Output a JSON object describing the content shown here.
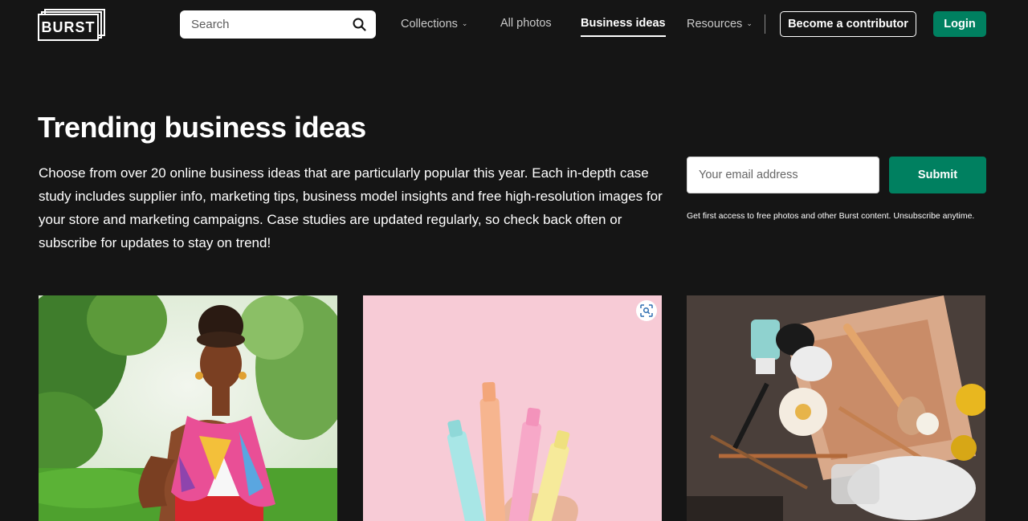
{
  "header": {
    "logo_text": "BURST",
    "search": {
      "placeholder": "Search",
      "value": ""
    },
    "nav": [
      {
        "label": "Collections",
        "has_dropdown": true,
        "active": false
      },
      {
        "label": "All photos",
        "has_dropdown": false,
        "active": false
      },
      {
        "label": "Business ideas",
        "has_dropdown": false,
        "active": true
      },
      {
        "label": "Resources",
        "has_dropdown": true,
        "active": false
      }
    ],
    "contributor_label": "Become a contributor",
    "login_label": "Login"
  },
  "hero": {
    "title": "Trending business ideas",
    "description": "Choose from over 20 online business ideas that are particularly popular this year. Each in-depth case study includes supplier info, marketing tips, business model insights and free high-resolution images for your store and marketing campaigns. Case studies are updated regularly, so check back often or subscribe for updates to stay on trend!"
  },
  "subscribe": {
    "email_placeholder": "Your email address",
    "email_value": "",
    "submit_label": "Submit",
    "note": "Get first access to free photos and other Burst content. Unsubscribe anytime."
  },
  "photos": [
    {
      "subject": "woman-in-colorful-scarf-in-park"
    },
    {
      "subject": "pastel-highlighters-on-pink"
    },
    {
      "subject": "makeup-brushes-and-cosmetics"
    }
  ],
  "colors": {
    "background": "#151515",
    "accent_green": "#008060",
    "text": "#ffffff",
    "nav_text": "#c9c9c9"
  },
  "icons": {
    "search": "search-icon",
    "dropdown": "chevron-down-icon",
    "visual_search": "visual-search-icon"
  }
}
